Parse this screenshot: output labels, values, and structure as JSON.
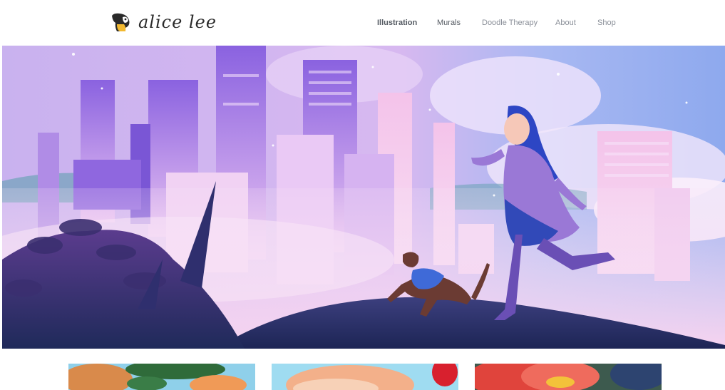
{
  "brand": {
    "name": "alice lee"
  },
  "nav": {
    "items": [
      {
        "label": "Illustration"
      },
      {
        "label": "Murals"
      },
      {
        "label": "Doodle Therapy"
      },
      {
        "label": "About"
      },
      {
        "label": "Shop"
      }
    ]
  },
  "colors": {
    "nav_text": "#8a8f98",
    "nav_active": "#555b63",
    "hero_sky": "#b9a6e8",
    "hero_pink": "#f6d6f2"
  }
}
